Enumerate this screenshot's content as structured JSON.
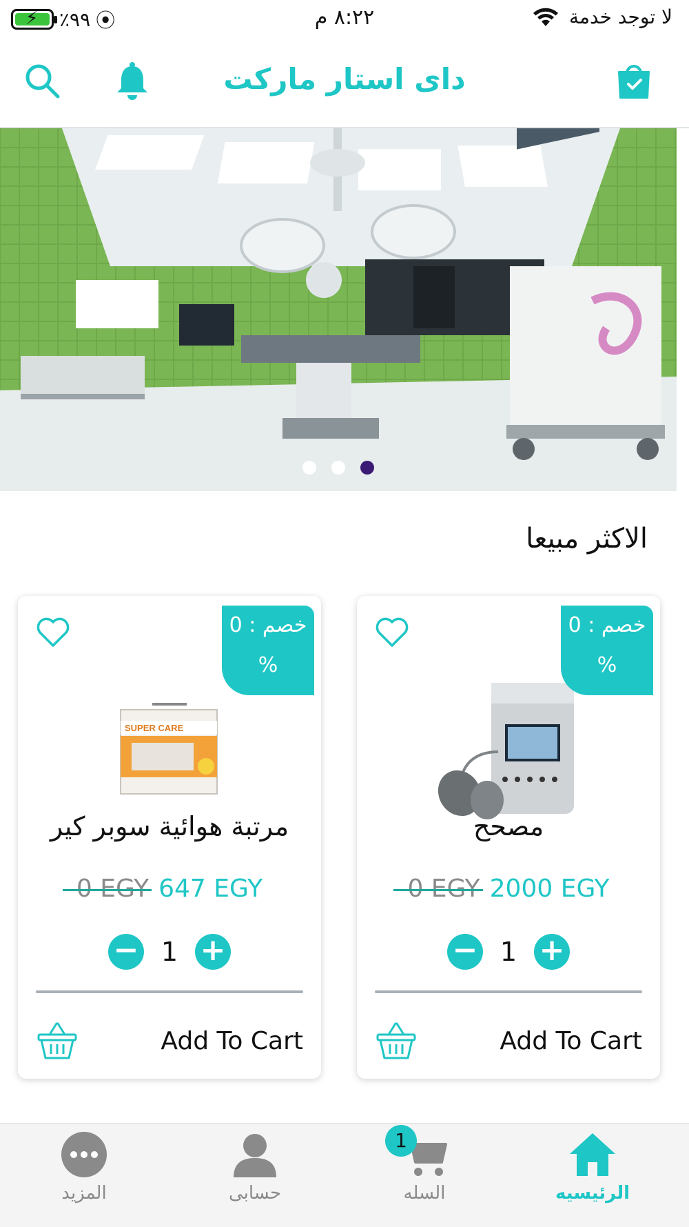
{
  "status_bar": {
    "battery_percent": "٪٩٩",
    "battery_level": 0.99,
    "time": "٨:٢٢ م",
    "carrier": "لا توجد خدمة"
  },
  "header": {
    "title": "داى استار ماركت",
    "icons": [
      "search-icon",
      "bell-icon",
      "shopping-bag-icon"
    ]
  },
  "banner": {
    "slides": 3,
    "active_slide": 3,
    "dot_active_color": "#3a1a73"
  },
  "section": {
    "title": "الاكثر مبيعا"
  },
  "products": [
    {
      "name": "مرتبة هوائية سوبر كير",
      "discount_label": "خصم : 0",
      "discount_unit": "%",
      "old_price": "0 EGY",
      "new_price": "647 EGY",
      "quantity": "1",
      "add_to_cart": "Add To Cart",
      "image_text": "SUPER CARE"
    },
    {
      "name": "مصحح",
      "discount_label": "خصم : 0",
      "discount_unit": "%",
      "old_price": "0 EGY",
      "new_price": "2000 EGY",
      "quantity": "1",
      "add_to_cart": "Add To Cart"
    }
  ],
  "tabbar": {
    "home": "الرئيسيه",
    "cart": "السله",
    "cart_badge": "1",
    "account": "حسابى",
    "more": "المزيد"
  },
  "colors": {
    "accent": "#1fc6c6",
    "inactive": "#8a8a8a"
  }
}
